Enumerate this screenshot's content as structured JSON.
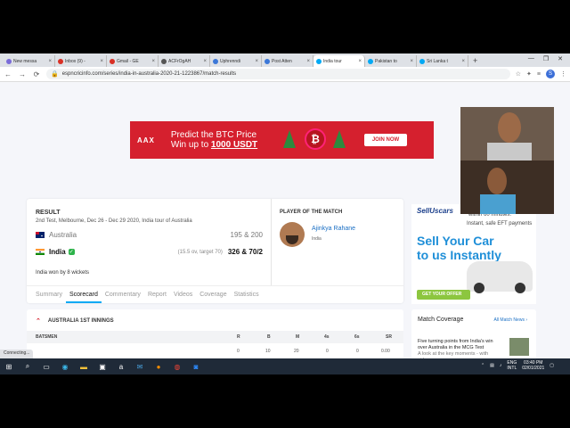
{
  "browser": {
    "tabs": [
      {
        "label": "New messa",
        "color": "#7b6cd9",
        "active": false
      },
      {
        "label": "Inbox (9) -",
        "color": "#d93025",
        "active": false
      },
      {
        "label": "Gmail - GE",
        "color": "#d93025",
        "active": false
      },
      {
        "label": "ACFrOgAH",
        "color": "#555555",
        "active": false
      },
      {
        "label": "Uphrenndi",
        "color": "#3c78d8",
        "active": false
      },
      {
        "label": "Post Atten",
        "color": "#3c78d8",
        "active": false
      },
      {
        "label": "India tour",
        "color": "#03a9f4",
        "active": true
      },
      {
        "label": "Pakistan to",
        "color": "#03a9f4",
        "active": false
      },
      {
        "label": "Sri Lanka t",
        "color": "#03a9f4",
        "active": false
      }
    ],
    "new_tab": "+",
    "url": "espncricinfo.com/series/india-in-australia-2020-21-1223867/match-results",
    "profile_initial": "S"
  },
  "ad_banner": {
    "brand": "AAX",
    "line1": "Predict the BTC Price",
    "line2_prefix": "Win up to ",
    "line2_amount": "1000 USDT",
    "btc_symbol": "₿",
    "cta": "JOIN NOW"
  },
  "match": {
    "result_label": "RESULT",
    "info": "2nd Test, Melbourne, Dec 26 - Dec 29 2020, India tour of Australia",
    "team1": {
      "name": "Australia",
      "score": "195 & 200"
    },
    "team2": {
      "name": "India",
      "overs": "(15.5 ov, target 70)",
      "score": "326 & 70/2"
    },
    "won_by": "India won by 8 wickets",
    "potm_label": "PLAYER OF THE MATCH",
    "potm_name": "Ajinkya Rahane",
    "potm_team": "India",
    "tabs": [
      "Summary",
      "Scorecard",
      "Commentary",
      "Report",
      "Videos",
      "Coverage",
      "Statistics"
    ]
  },
  "innings": {
    "title": "AUSTRALIA 1ST INNINGS",
    "headers": {
      "batsmen": "BATSMEN",
      "r": "R",
      "b": "B",
      "m": "M",
      "fours": "4s",
      "sixes": "6s",
      "sr": "SR"
    },
    "row": {
      "r": "0",
      "b": "10",
      "m": "20",
      "fours": "0",
      "sixes": "0",
      "sr": "0.00"
    }
  },
  "side_ad": {
    "logo": "SellUscars",
    "sub1": "within 60 minutes.",
    "sub2": "Instant, safe EFT payments",
    "headline1": "Sell Your Car",
    "headline2": "to us Instantly",
    "cta": "GET YOUR OFFER"
  },
  "coverage": {
    "title": "Match Coverage",
    "all_link": "All Match News",
    "story": "Five turning points from India's win over Australia in the MCG Test",
    "story_more": "A look at the key moments - with videos"
  },
  "status_text": "Connecting...",
  "tray": {
    "lang1": "ENG",
    "lang2": "INTL",
    "time": "03:40 PM",
    "date": "02/01/2021"
  }
}
